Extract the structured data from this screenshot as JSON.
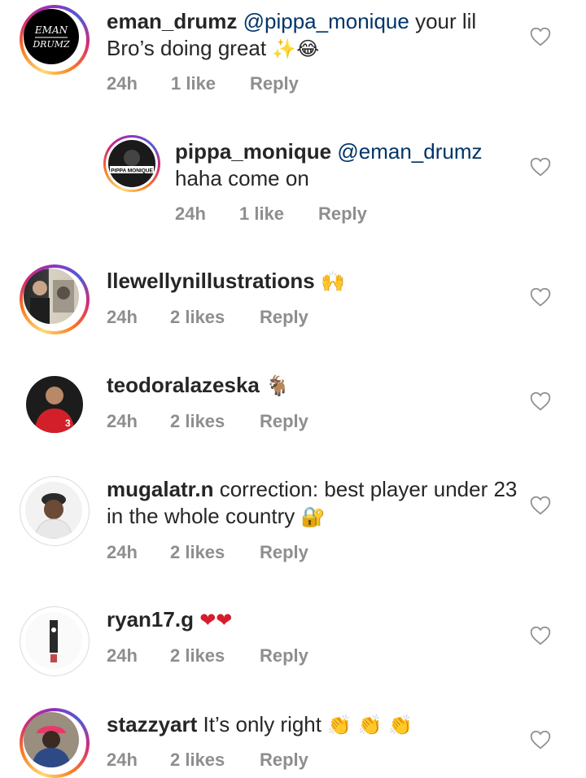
{
  "comments": [
    {
      "user": "eman_drumz",
      "mention": "@pippa_monique",
      "text_before": "",
      "text": "your lil Bro’s doing great",
      "emoji": "✨😂",
      "time": "24h",
      "likes": "1 like",
      "reply": "Reply",
      "avatar_text": "EMAN DRUMZ"
    },
    {
      "user": "pippa_monique",
      "mention": "@eman_drumz",
      "text": "haha come on",
      "emoji": "",
      "time": "24h",
      "likes": "1 like",
      "reply": "Reply",
      "avatar_text": "PIPPA MONIQUE"
    },
    {
      "user": "llewellynillustrations",
      "mention": "",
      "text": "",
      "emoji": "🙌",
      "time": "24h",
      "likes": "2 likes",
      "reply": "Reply"
    },
    {
      "user": "teodoralazeska",
      "mention": "",
      "text": "",
      "emoji": "🐐",
      "time": "24h",
      "likes": "2 likes",
      "reply": "Reply"
    },
    {
      "user": "mugalatr.n",
      "mention": "",
      "text": "correction: best player under 23 in the whole country",
      "emoji": "🔐",
      "time": "24h",
      "likes": "2 likes",
      "reply": "Reply"
    },
    {
      "user": "ryan17.g",
      "mention": "",
      "text": "",
      "emoji": "❤❤",
      "time": "24h",
      "likes": "2 likes",
      "reply": "Reply"
    },
    {
      "user": "stazzyart",
      "mention": "",
      "text": "It’s only right",
      "emoji": "👏 👏 👏",
      "time": "24h",
      "likes": "2 likes",
      "reply": "Reply"
    }
  ],
  "icons": {
    "like": "heart-outline-icon"
  },
  "colors": {
    "username": "#262626",
    "mention": "#003569",
    "meta": "#8e8e8e",
    "heart": "#8e8e8e"
  }
}
